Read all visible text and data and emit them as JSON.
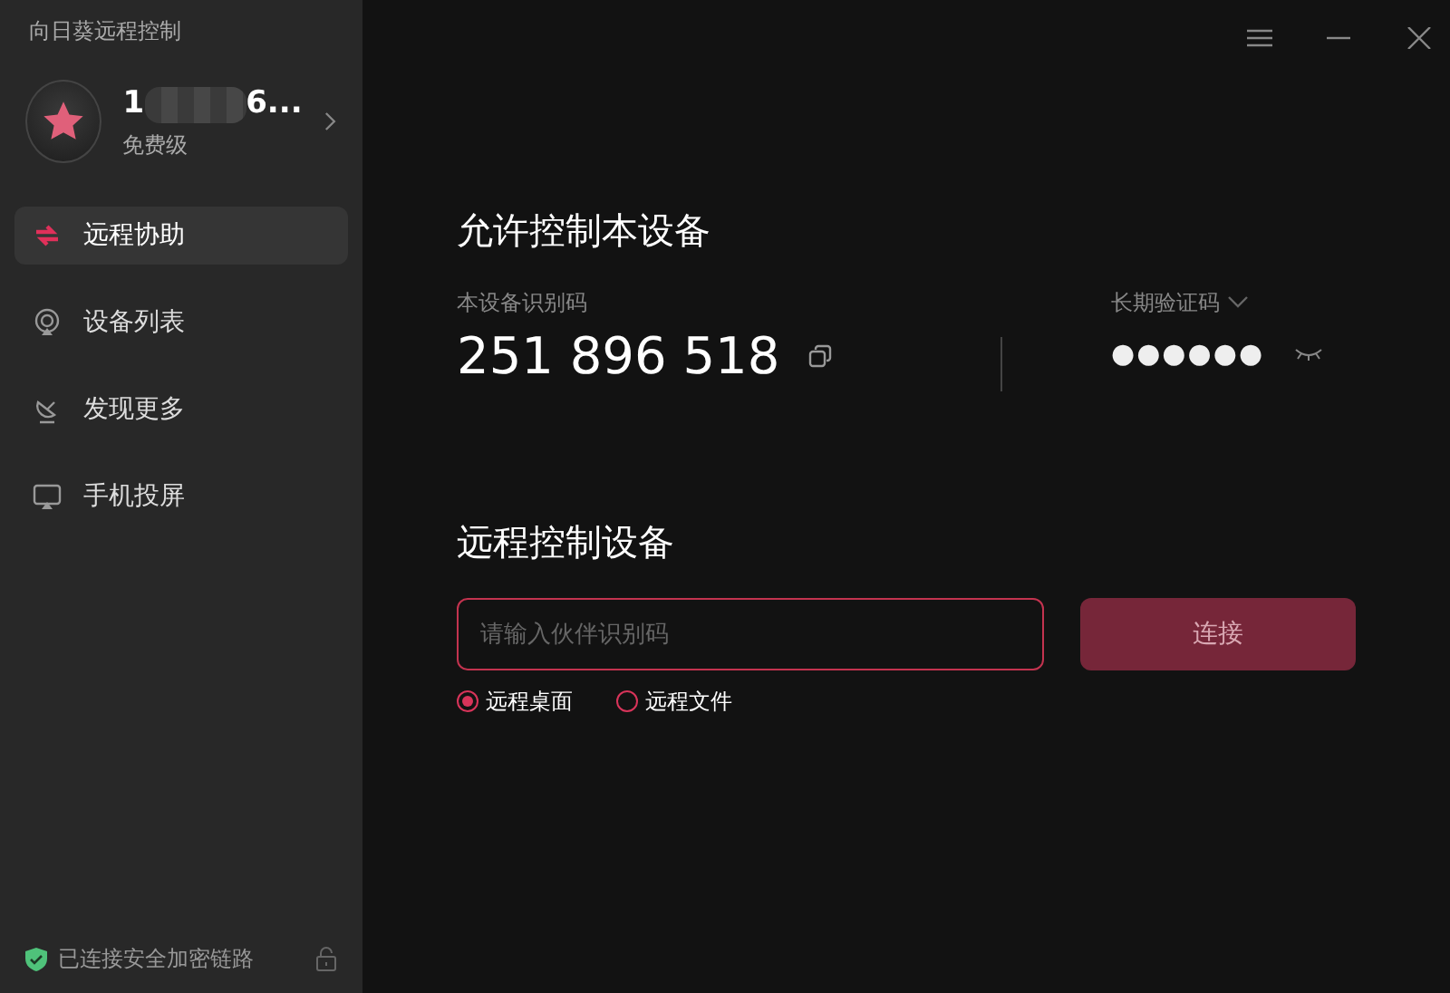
{
  "app_title": "向日葵远程控制",
  "account": {
    "name_start": "1",
    "name_end": "6...",
    "plan": "免费级"
  },
  "nav": [
    {
      "label": "远程协助",
      "kind": "assist",
      "selected": true
    },
    {
      "label": "设备列表",
      "kind": "devices",
      "selected": false
    },
    {
      "label": "发现更多",
      "kind": "discover",
      "selected": false
    },
    {
      "label": "手机投屏",
      "kind": "cast",
      "selected": false
    }
  ],
  "status": {
    "text": "已连接安全加密链路",
    "locked": false
  },
  "allow": {
    "title": "允许控制本设备",
    "id_label": "本设备识别码",
    "id": "251 896 518",
    "code_label": "长期验证码",
    "code": "●●●●●●"
  },
  "remote": {
    "title": "远程控制设备",
    "placeholder": "请输入伙伴识别码",
    "button": "连接",
    "modes": [
      {
        "label": "远程桌面",
        "selected": true
      },
      {
        "label": "远程文件",
        "selected": false
      }
    ]
  }
}
